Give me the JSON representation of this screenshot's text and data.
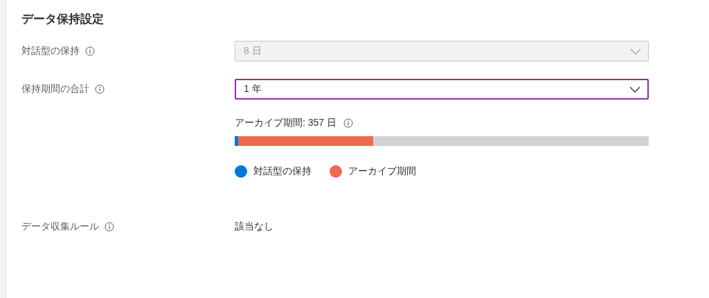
{
  "title": "データ保持設定",
  "fields": [
    {
      "label": "対話型の保持",
      "value": "8 日",
      "disabled": true,
      "focused": false
    },
    {
      "label": "保持期間の合計",
      "value": "1 年",
      "disabled": false,
      "focused": true
    }
  ],
  "archive": {
    "label": "アーカイブ期間: 357 日",
    "segments": [
      {
        "color": "#0078d4",
        "level": 0.009
      },
      {
        "color": "#ef6950",
        "level": 0.326
      }
    ],
    "legend": [
      {
        "label": "対話型の保持",
        "color": "#0078d4"
      },
      {
        "label": "アーカイブ期間",
        "color": "#ef6950"
      }
    ]
  },
  "rule": {
    "label": "データ収集ルール",
    "value": "該当なし"
  }
}
